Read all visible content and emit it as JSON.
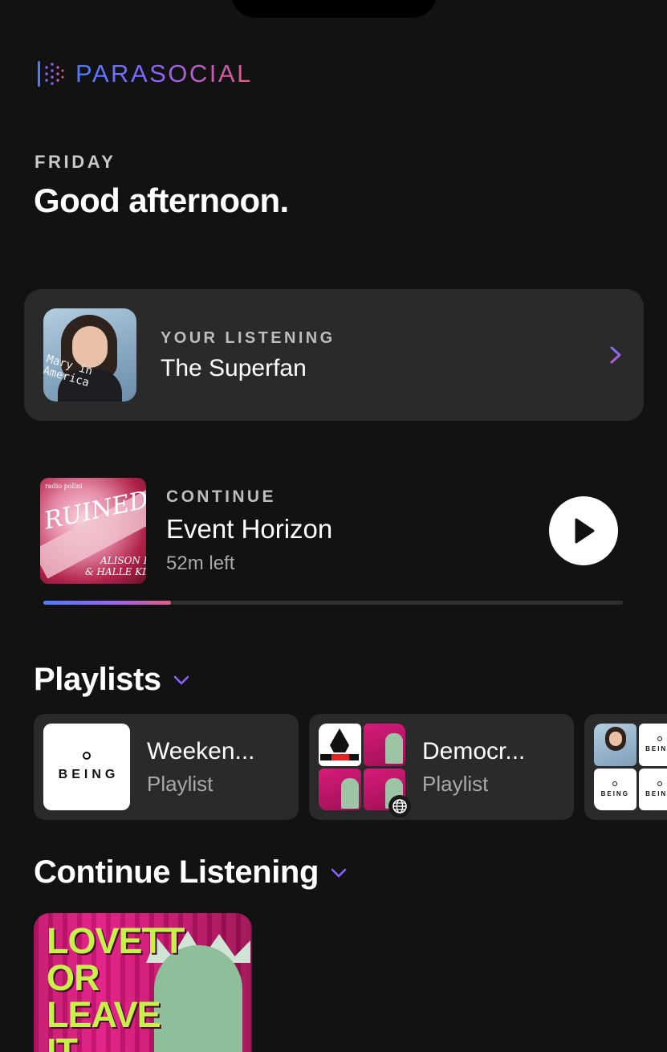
{
  "app": {
    "name": "PARASOCIAL"
  },
  "header": {
    "day": "FRIDAY",
    "greeting": "Good afternoon."
  },
  "your_listening": {
    "eyebrow": "YOUR LISTENING",
    "title": "The Superfan",
    "artwork_text": "Mary in\nAmerica"
  },
  "continue": {
    "eyebrow": "CONTINUE",
    "title": "Event Horizon",
    "time_left": "52m left",
    "progress": 0.22,
    "artwork": {
      "publisher": "radio pollni",
      "title": "RUINED!",
      "hosts": "WITH\nALISON LEIBY\n& HALLE KIEFER"
    }
  },
  "playlists": {
    "section_title": "Playlists",
    "items": [
      {
        "title": "Weeken...",
        "subtitle": "Playlist",
        "art_word": "BEING"
      },
      {
        "title": "Democr...",
        "subtitle": "Playlist"
      }
    ]
  },
  "continue_listening": {
    "section_title": "Continue Listening",
    "artwork_text": "LOVETT\nOR\nLEAVE\nIT"
  },
  "colors": {
    "background": "#121212",
    "card": "#2a2a2a",
    "accent_purple": "#8a63ff",
    "accent_blue": "#4f7bff",
    "accent_pink": "#e05d87"
  },
  "icons": [
    "parasocial-logo-icon",
    "chevron-right-icon",
    "play-icon",
    "chevron-down-icon",
    "globe-icon"
  ]
}
